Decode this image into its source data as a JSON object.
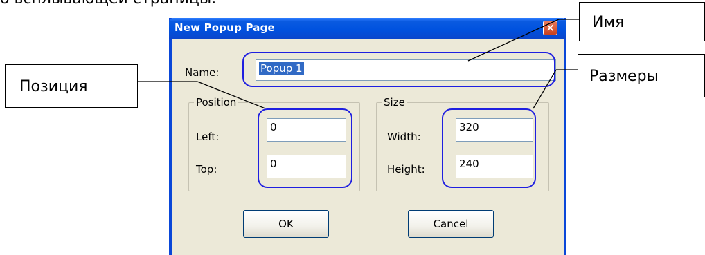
{
  "top_cut_text": "о всплывающей страницы.",
  "dialog": {
    "title": "New Popup Page",
    "close_glyph": "×",
    "name_label": "Name:",
    "name_value": "Popup 1",
    "position": {
      "legend": "Position",
      "left_label": "Left:",
      "left_value": "0",
      "top_label": "Top:",
      "top_value": "0"
    },
    "size": {
      "legend": "Size",
      "width_label": "Width:",
      "width_value": "320",
      "height_label": "Height:",
      "height_value": "240"
    },
    "ok_label": "OK",
    "cancel_label": "Cancel"
  },
  "callouts": {
    "name": "Имя",
    "position": "Позиция",
    "size": "Размеры"
  },
  "colors": {
    "titlebar": "#0052df",
    "dialog_bg": "#ece9d8",
    "highlight_ring": "#1f1fe0",
    "selection": "#316ac5"
  }
}
